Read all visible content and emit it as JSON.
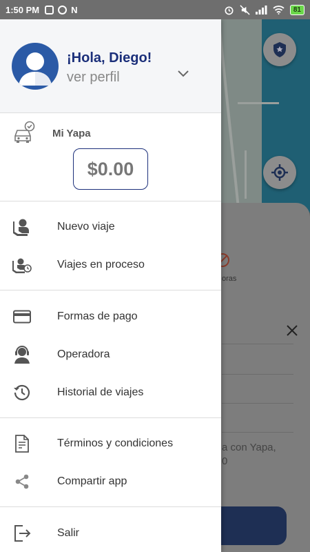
{
  "status_bar": {
    "time": "1:50 PM",
    "battery": "81"
  },
  "profile": {
    "greeting": "¡Hola, Diego!",
    "profile_link": "ver perfil"
  },
  "yapa": {
    "label": "Mi Yapa",
    "balance": "$0.00"
  },
  "menu": {
    "new_trip": "Nuevo viaje",
    "trips_in_progress": "Viajes en proceso",
    "payment_methods": "Formas de pago",
    "operator": "Operadora",
    "trip_history": "Historial de viajes",
    "terms": "Términos y condiciones",
    "share_app": "Compartir app",
    "logout": "Salir"
  },
  "background": {
    "partial_label_1": "oras",
    "partial_text_1": "a con Yapa,",
    "partial_text_2": "0"
  },
  "colors": {
    "brand_navy": "#1b2f7a",
    "accent_blue": "#2b5aa6",
    "battery_green": "#6bd84a"
  }
}
